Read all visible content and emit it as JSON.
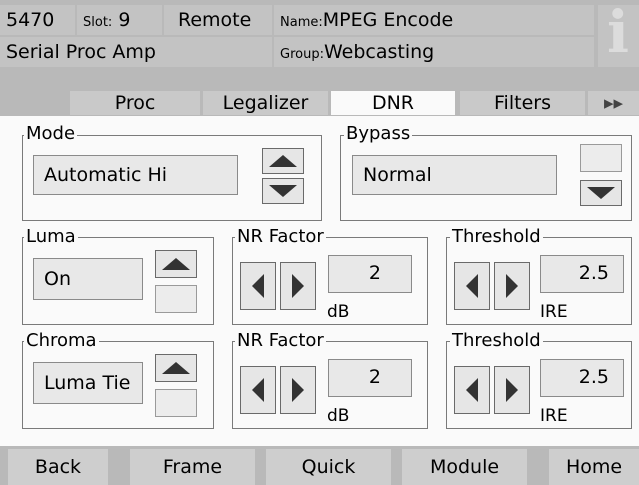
{
  "header": {
    "id": "5470",
    "slot_label": "Slot:",
    "slot_value": "9",
    "mode": "Remote",
    "name_label": "Name:",
    "name_value": "MPEG Encode",
    "device": "Serial Proc Amp",
    "group_label": "Group:",
    "group_value": "Webcasting",
    "info_glyph": "i"
  },
  "tabs": [
    {
      "label": "Proc",
      "active": false
    },
    {
      "label": "Legalizer",
      "active": false
    },
    {
      "label": "DNR",
      "active": true
    },
    {
      "label": "Filters",
      "active": false
    },
    {
      "label": "▸▸",
      "active": false
    }
  ],
  "mode_panel": {
    "legend": "Mode",
    "value": "Automatic Hi"
  },
  "bypass_panel": {
    "legend": "Bypass",
    "value": "Normal"
  },
  "luma_panel": {
    "legend": "Luma",
    "value": "On"
  },
  "chroma_panel": {
    "legend": "Chroma",
    "value": "Luma Tie"
  },
  "luma_nr": {
    "legend": "NR Factor",
    "value": "2",
    "unit": "dB"
  },
  "luma_threshold": {
    "legend": "Threshold",
    "value": "2.5",
    "unit": "IRE"
  },
  "chroma_nr": {
    "legend": "NR Factor",
    "value": "2",
    "unit": "dB"
  },
  "chroma_threshold": {
    "legend": "Threshold",
    "value": "2.5",
    "unit": "IRE"
  },
  "bottom": {
    "back": "Back",
    "frame": "Frame",
    "quick": "Quick",
    "module": "Module",
    "home": "Home"
  },
  "icons": [
    "up-arrow-icon",
    "down-arrow-icon",
    "left-arrow-icon",
    "right-arrow-icon",
    "info-icon"
  ]
}
